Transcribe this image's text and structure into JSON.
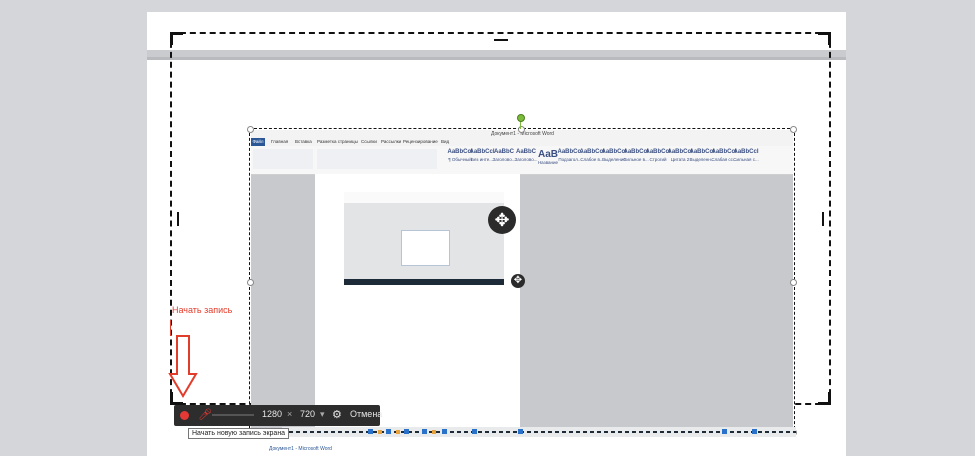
{
  "recorder": {
    "start_label": "Начать запись",
    "width": "1280",
    "times": "×",
    "height": "720",
    "cancel": "Отмена",
    "tooltip": "Начать новую запись экрана",
    "accent_color": "#e53935"
  },
  "word": {
    "title": "Документ1 - Microsoft Word",
    "file_tab": "Файл",
    "tabs": [
      "Главная",
      "Вставка",
      "Разметка страницы",
      "Ссылки",
      "Рассылки",
      "Рецензирование",
      "Вид"
    ],
    "styles": [
      {
        "sample": "AaBbCcI",
        "name": "¶ Обычный"
      },
      {
        "sample": "AaBbCcI",
        "name": "Без инте..."
      },
      {
        "sample": "AaBbC",
        "name": "Заголово..."
      },
      {
        "sample": "AaBbC",
        "name": "Заголово..."
      },
      {
        "sample": "AaB",
        "name": "Название"
      },
      {
        "sample": "AaBbCc.",
        "name": "Подзагол..."
      },
      {
        "sample": "AaBbCcI",
        "name": "Слабое в..."
      },
      {
        "sample": "AaBbCcI",
        "name": "Выделение"
      },
      {
        "sample": "AaBbCcI",
        "name": "Сильное в..."
      },
      {
        "sample": "AaBbCcI",
        "name": "Строгий"
      },
      {
        "sample": "AaBbCcI",
        "name": "Цитата 2"
      },
      {
        "sample": "AaBbCcI",
        "name": "Выделенн..."
      },
      {
        "sample": "AaBbCcI",
        "name": "Слабая сс..."
      },
      {
        "sample": "AaBbCcI",
        "name": "Сильная с..."
      }
    ]
  },
  "icons": {
    "move": "move-icon",
    "settings": "gear-icon",
    "mic": "mic-icon"
  }
}
